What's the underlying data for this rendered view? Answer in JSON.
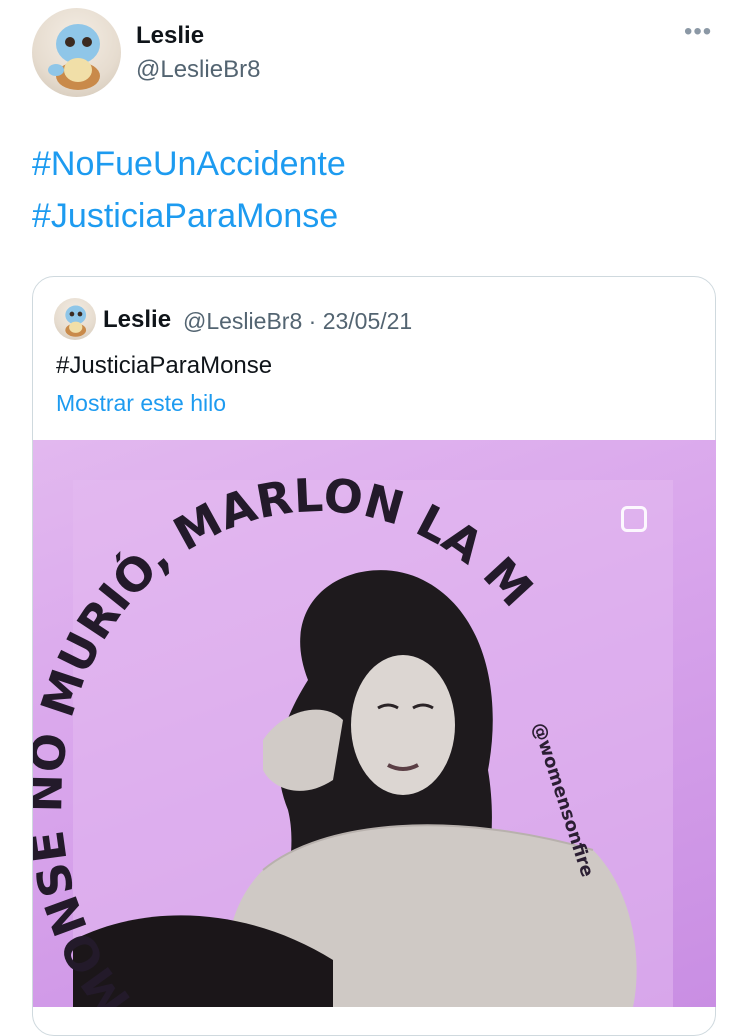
{
  "tweet": {
    "author_name": "Leslie",
    "author_handle": "@LeslieBr8",
    "more_label": "•••",
    "hashtags": [
      "#NoFueUnAccidente",
      "#JusticiaParaMonse"
    ]
  },
  "quoted_tweet": {
    "author_name": "Leslie",
    "author_handle": "@LeslieBr8",
    "separator": "·",
    "date": "23/05/21",
    "text": "#JusticiaParaMonse",
    "show_thread": "Mostrar este hilo"
  },
  "media": {
    "headline": "MONSE NO MURIÓ, MARLON LA MATÓ",
    "watermark": "@womensonfire",
    "background_color": "#d9a6ec"
  },
  "colors": {
    "link": "#1d9bf0",
    "text": "#0f1419",
    "secondary": "#536471",
    "border": "#cfd9de"
  }
}
